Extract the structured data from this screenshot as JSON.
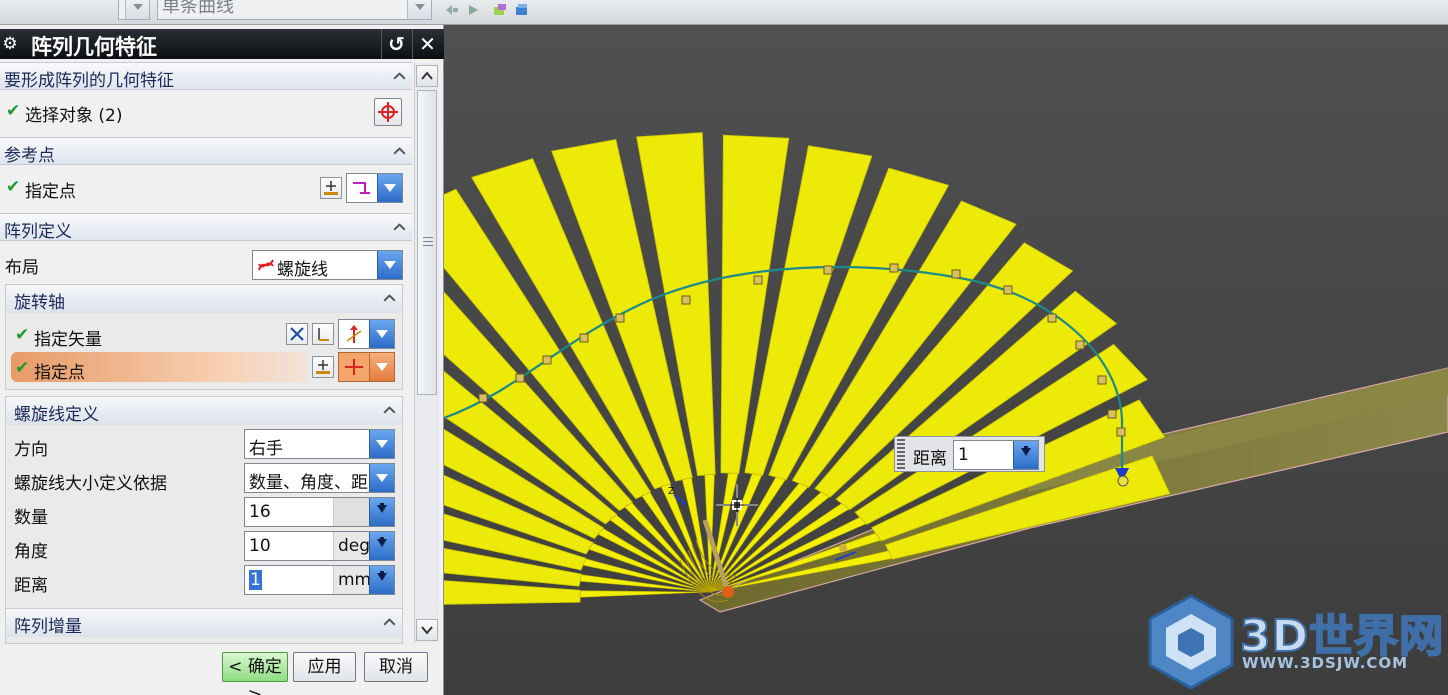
{
  "toolbar": {
    "curve_filter": "单条曲线"
  },
  "dialog": {
    "title": "阵列几何特征",
    "sections": {
      "geometry": {
        "header": "要形成阵列的几何特征",
        "select_object": "选择对象 (2)"
      },
      "reference_point": {
        "header": "参考点",
        "specify_point": "指定点"
      },
      "pattern_definition": {
        "header": "阵列定义",
        "layout_label": "布局",
        "layout_value": "螺旋线"
      },
      "rotation_axis": {
        "header": "旋转轴",
        "specify_vector": "指定矢量",
        "specify_point": "指定点"
      },
      "helix_definition": {
        "header": "螺旋线定义",
        "direction_label": "方向",
        "direction_value": "右手",
        "size_basis_label": "螺旋线大小定义依据",
        "size_basis_value": "数量、角度、距",
        "count_label": "数量",
        "count_value": "16",
        "angle_label": "角度",
        "angle_value": "10",
        "angle_unit": "deg",
        "distance_label": "距离",
        "distance_value": "1",
        "distance_unit": "mm"
      },
      "pattern_increment": {
        "header": "阵列增量"
      }
    },
    "buttons": {
      "ok": "< 确定 >",
      "apply": "应用",
      "cancel": "取消"
    }
  },
  "viewport": {
    "distance_tooltip": {
      "label": "距离",
      "value": "1"
    },
    "watermark": {
      "text": "3D世界网",
      "url": "WWW.3DSJW.COM"
    }
  },
  "colors": {
    "fan_blade": "#ecea06",
    "helix_curve": "#1c8a8a",
    "accent_blue": "#2d6cc7",
    "check_green": "#1f9a2f"
  }
}
